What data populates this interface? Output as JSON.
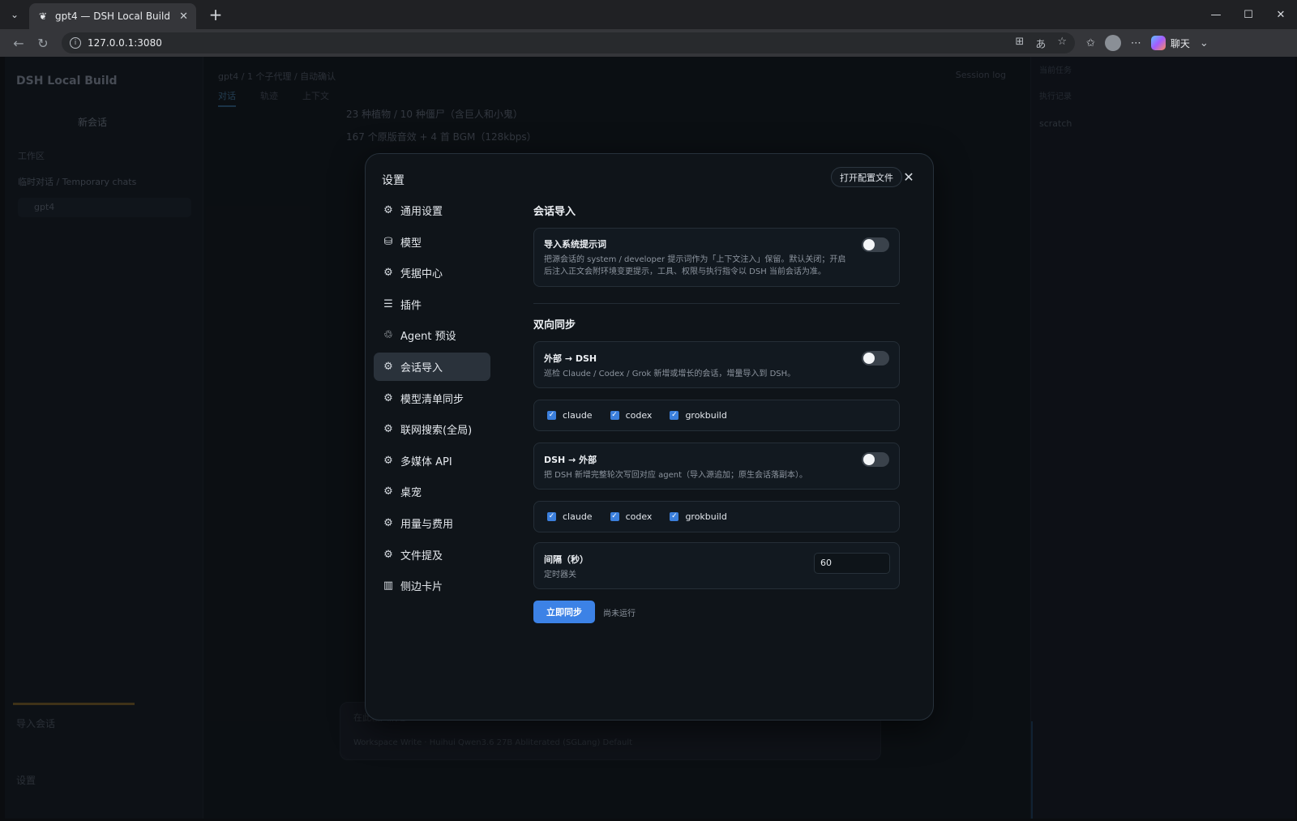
{
  "browser": {
    "tab_title": "gpt4 — DSH Local Build",
    "url": "127.0.0.1:3080",
    "copilot_label": "聊天"
  },
  "app": {
    "brand": "DSH Local Build",
    "new_chat": "新会话",
    "workspace_label": "工作区",
    "group_label": "临时对话 / Temporary chats",
    "chat_item": "gpt4",
    "import_label": "导入会话",
    "settings_label": "设置",
    "breadcrumb": "gpt4  /  1 个子代理  /  自动确认",
    "tabs": [
      "对话",
      "轨迹",
      "上下文"
    ],
    "session_log": "Session log",
    "body_lines": [
      "23 种植物 / 10 种僵尸（含巨人和小鬼）",
      "167 个原版音效 + 4 首 BGM（128kbps）"
    ],
    "composer_placeholder": "在此输入消息…",
    "composer_row": "Workspace Write   ·   Huihui Qwen3.6 27B Abliterated (SGLang) Default",
    "right_l1": "当前任务",
    "right_l2": "执行记录",
    "right_scratch": "scratch"
  },
  "modal": {
    "title": "设置",
    "open_config": "打开配置文件",
    "nav": [
      {
        "label": "通用设置",
        "icon": "gear-icon",
        "glyph": "⚙"
      },
      {
        "label": "模型",
        "icon": "database-icon",
        "glyph": "⛁"
      },
      {
        "label": "凭据中心",
        "icon": "gear-icon",
        "glyph": "⚙"
      },
      {
        "label": "插件",
        "icon": "sliders-icon",
        "glyph": "☰"
      },
      {
        "label": "Agent 预设",
        "icon": "recycle-icon",
        "glyph": "♲"
      },
      {
        "label": "会话导入",
        "icon": "gear-icon",
        "glyph": "⚙",
        "active": true
      },
      {
        "label": "模型清单同步",
        "icon": "gear-icon",
        "glyph": "⚙"
      },
      {
        "label": "联网搜索(全局)",
        "icon": "gear-icon",
        "glyph": "⚙"
      },
      {
        "label": "多媒体 API",
        "icon": "gear-icon",
        "glyph": "⚙"
      },
      {
        "label": "桌宠",
        "icon": "gear-icon",
        "glyph": "⚙"
      },
      {
        "label": "用量与费用",
        "icon": "gear-icon",
        "glyph": "⚙"
      },
      {
        "label": "文件提及",
        "icon": "gear-icon",
        "glyph": "⚙"
      },
      {
        "label": "侧边卡片",
        "icon": "panels-icon",
        "glyph": "▥"
      }
    ],
    "section_import": {
      "title": "会话导入",
      "import_system": {
        "title": "导入系统提示词",
        "desc": "把源会话的 system / developer 提示词作为「上下文注入」保留。默认关闭；开启后注入正文会附环境变更提示，工具、权限与执行指令以 DSH 当前会话为准。",
        "enabled": false
      }
    },
    "section_sync": {
      "title": "双向同步",
      "external_to_dsh": {
        "title": "外部 → DSH",
        "desc": "巡检 Claude / Codex / Grok 新增或增长的会话，增量导入到 DSH。",
        "enabled": false,
        "sources": [
          {
            "label": "claude",
            "checked": true
          },
          {
            "label": "codex",
            "checked": true
          },
          {
            "label": "grokbuild",
            "checked": true
          }
        ]
      },
      "dsh_to_external": {
        "title": "DSH → 外部",
        "desc": "把 DSH 新增完整轮次写回对应 agent（导入源追加；原生会话落副本）。",
        "enabled": false,
        "targets": [
          {
            "label": "claude",
            "checked": true
          },
          {
            "label": "codex",
            "checked": true
          },
          {
            "label": "grokbuild",
            "checked": true
          }
        ]
      },
      "interval": {
        "title": "间隔（秒）",
        "desc": "定时器关",
        "value": "60"
      },
      "sync_now": "立即同步",
      "status": "尚未运行"
    }
  }
}
